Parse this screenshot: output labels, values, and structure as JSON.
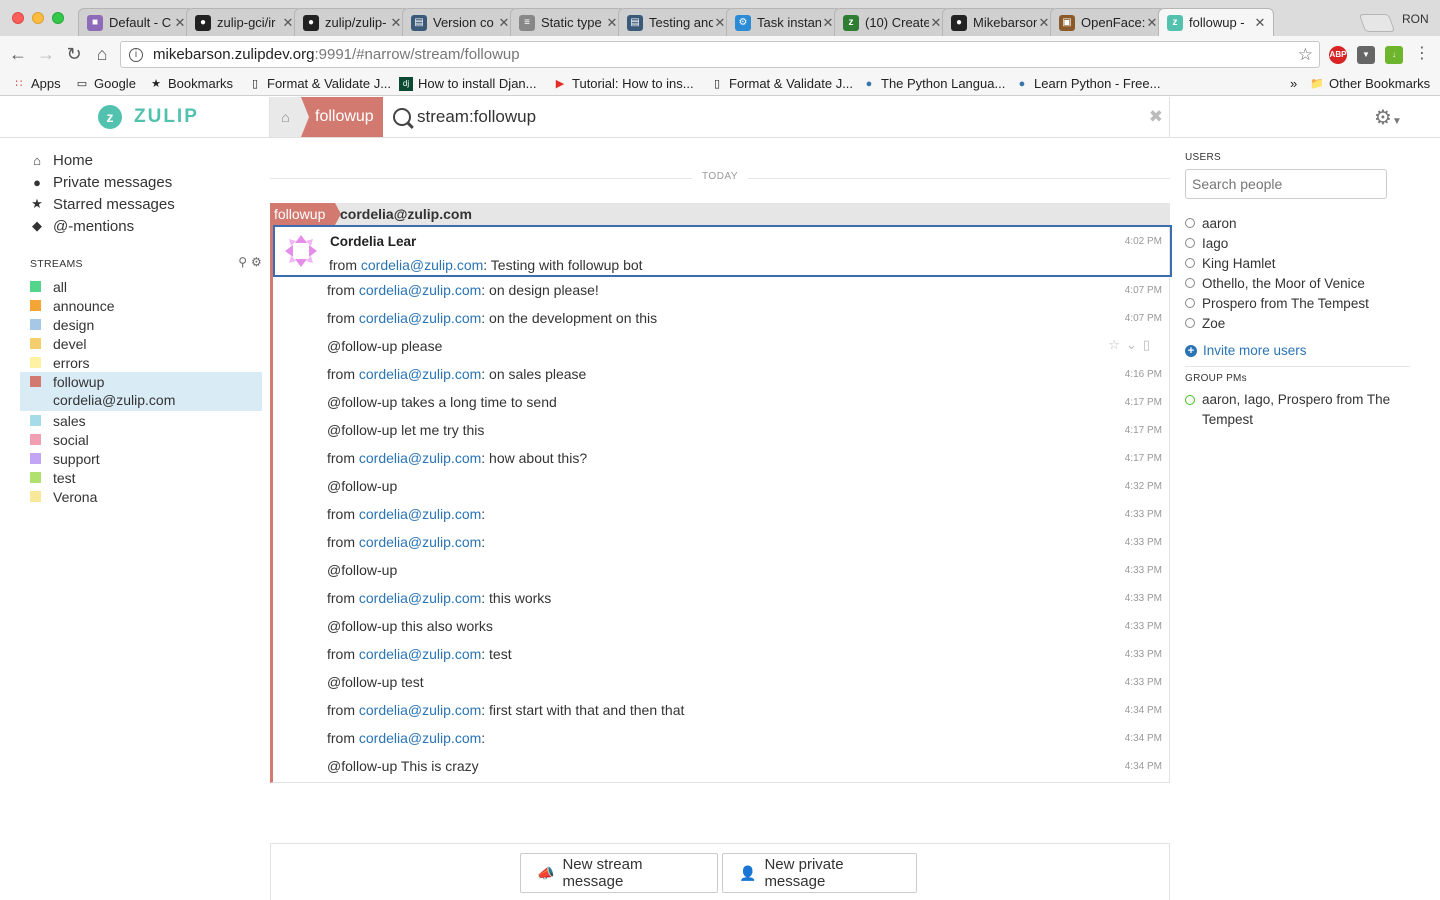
{
  "browser": {
    "profile": "RON",
    "tabs": [
      {
        "title": "Default - C",
        "icon": "cube-icon",
        "color": "#8e6bb8"
      },
      {
        "title": "zulip-gci/ir",
        "icon": "github-icon",
        "color": "#222222"
      },
      {
        "title": "zulip/zulip-",
        "icon": "github-icon",
        "color": "#222222"
      },
      {
        "title": "Version co",
        "icon": "doc-icon",
        "color": "#3b5a7a"
      },
      {
        "title": "Static type",
        "icon": "lines-icon",
        "color": "#888888"
      },
      {
        "title": "Testing and",
        "icon": "doc-icon",
        "color": "#3b5a7a"
      },
      {
        "title": "Task instan",
        "icon": "gear-icon",
        "color": "#2a8bd6"
      },
      {
        "title": "(10) Create",
        "icon": "zulip-icon",
        "color": "#2e7d32"
      },
      {
        "title": "Mikebarson",
        "icon": "github-icon",
        "color": "#222222"
      },
      {
        "title": "OpenFace:",
        "icon": "image-icon",
        "color": "#8a5a2b"
      },
      {
        "title": "followup - ",
        "icon": "zulip-icon",
        "color": "#52c2af"
      }
    ],
    "url_host": "mikebarson.zulipdev.org",
    "url_path": ":9991/#narrow/stream/followup",
    "bookmarks": [
      {
        "label": "Apps",
        "icon": "apps-grid-icon"
      },
      {
        "label": "Google",
        "icon": "folder-icon"
      },
      {
        "label": "Bookmarks",
        "icon": "star-icon"
      },
      {
        "label": "Format & Validate J...",
        "icon": "page-icon"
      },
      {
        "label": "How to install Djan...",
        "icon": "django-icon"
      },
      {
        "label": "Tutorial: How to ins...",
        "icon": "youtube-icon"
      },
      {
        "label": "Format & Validate J...",
        "icon": "page-icon"
      },
      {
        "label": "The Python Langua...",
        "icon": "python-icon"
      },
      {
        "label": "Learn Python - Free...",
        "icon": "python-icon"
      }
    ],
    "other_bookmarks": "Other Bookmarks",
    "overflow": "»"
  },
  "app": {
    "brand": "ZULIP",
    "narrow_stream": "followup",
    "search_query": "stream:followup",
    "nav": [
      {
        "label": "Home",
        "icon": "home-icon"
      },
      {
        "label": "Private messages",
        "icon": "user-icon"
      },
      {
        "label": "Starred messages",
        "icon": "star-icon"
      },
      {
        "label": "@-mentions",
        "icon": "tag-icon"
      }
    ],
    "streams_heading": "STREAMS",
    "streams": [
      {
        "name": "all",
        "color": "#53d58b"
      },
      {
        "name": "announce",
        "color": "#f5a535"
      },
      {
        "name": "design",
        "color": "#a6c7e5"
      },
      {
        "name": "devel",
        "color": "#f5ce6e"
      },
      {
        "name": "errors",
        "color": "#fff2a3"
      },
      {
        "name": "followup",
        "color": "#d37a70"
      },
      {
        "name": "sales",
        "color": "#a6dcea"
      },
      {
        "name": "social",
        "color": "#f0a0b0"
      },
      {
        "name": "support",
        "color": "#c2a6f5"
      },
      {
        "name": "test",
        "color": "#b0e070"
      },
      {
        "name": "Verona",
        "color": "#f8e89a"
      }
    ],
    "active_topic": "cordelia@zulip.com",
    "date_divider": "TODAY",
    "recipient_stream": "followup",
    "recipient_topic": "cordelia@zulip.com",
    "first_message": {
      "sender": "Cordelia Lear",
      "prefix": "from ",
      "link": "cordelia@zulip.com",
      "suffix": ": Testing with followup bot",
      "time": "4:02 PM"
    },
    "messages": [
      {
        "prefix": "from ",
        "link": "cordelia@zulip.com",
        "suffix": ": on design please!",
        "time": "4:07 PM"
      },
      {
        "prefix": "from ",
        "link": "cordelia@zulip.com",
        "suffix": ": on the development on this",
        "time": "4:07 PM"
      },
      {
        "prefix": "@follow-up please",
        "link": "",
        "suffix": "",
        "time": ""
      },
      {
        "prefix": "from ",
        "link": "cordelia@zulip.com",
        "suffix": ": on sales please",
        "time": "4:16 PM"
      },
      {
        "prefix": "@follow-up takes a long time to send",
        "link": "",
        "suffix": "",
        "time": "4:17 PM"
      },
      {
        "prefix": "@follow-up let me try this",
        "link": "",
        "suffix": "",
        "time": "4:17 PM"
      },
      {
        "prefix": "from ",
        "link": "cordelia@zulip.com",
        "suffix": ": how about this?",
        "time": "4:17 PM"
      },
      {
        "prefix": "@follow-up",
        "link": "",
        "suffix": "",
        "time": "4:32 PM"
      },
      {
        "prefix": "from ",
        "link": "cordelia@zulip.com",
        "suffix": ":",
        "time": "4:33 PM"
      },
      {
        "prefix": "from ",
        "link": "cordelia@zulip.com",
        "suffix": ":",
        "time": "4:33 PM"
      },
      {
        "prefix": "@follow-up",
        "link": "",
        "suffix": "",
        "time": "4:33 PM"
      },
      {
        "prefix": "from ",
        "link": "cordelia@zulip.com",
        "suffix": ": this works",
        "time": "4:33 PM"
      },
      {
        "prefix": "@follow-up this also works",
        "link": "",
        "suffix": "",
        "time": "4:33 PM"
      },
      {
        "prefix": "from ",
        "link": "cordelia@zulip.com",
        "suffix": ": test",
        "time": "4:33 PM"
      },
      {
        "prefix": "@follow-up test",
        "link": "",
        "suffix": "",
        "time": "4:33 PM"
      },
      {
        "prefix": "from ",
        "link": "cordelia@zulip.com",
        "suffix": ": first start with that and then that",
        "time": "4:34 PM"
      },
      {
        "prefix": "from ",
        "link": "cordelia@zulip.com",
        "suffix": ":",
        "time": "4:34 PM"
      },
      {
        "prefix": "@follow-up This is crazy",
        "link": "",
        "suffix": "",
        "time": "4:34 PM"
      }
    ],
    "compose": {
      "new_stream": "New stream message",
      "new_private": "New private message"
    },
    "users_heading": "USERS",
    "search_people_placeholder": "Search people",
    "users": [
      "aaron",
      "Iago",
      "King Hamlet",
      "Othello, the Moor of Venice",
      "Prospero from The Tempest",
      "Zoe"
    ],
    "invite_label": "Invite more users",
    "group_pms_heading": "GROUP PMs",
    "group_pms": [
      "aaron, Iago, Prospero from The Tempest"
    ]
  }
}
